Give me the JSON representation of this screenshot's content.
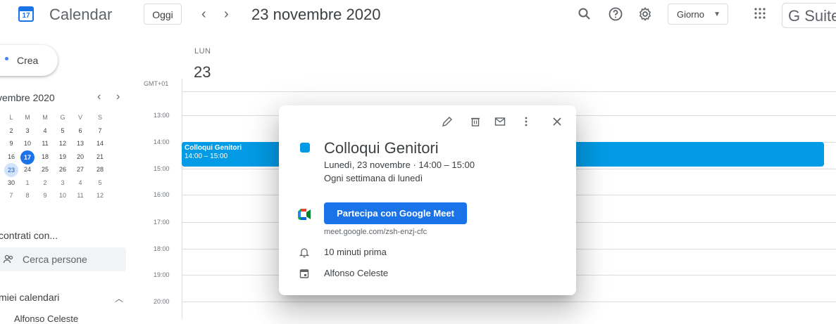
{
  "header": {
    "logo_day": "17",
    "app_title": "Calendar",
    "today_label": "Oggi",
    "prev_label": "‹",
    "next_label": "›",
    "date_title": "23 novembre 2020",
    "view_label": "Giorno",
    "gsuite_label": "G Suite"
  },
  "sidebar": {
    "create_label": "Crea",
    "mini_month": "vembre 2020",
    "weekdays": [
      "L",
      "M",
      "M",
      "G",
      "V",
      "S"
    ],
    "weeks": [
      [
        "2",
        "3",
        "4",
        "5",
        "6",
        "7"
      ],
      [
        "9",
        "10",
        "11",
        "12",
        "13",
        "14"
      ],
      [
        "16",
        "17",
        "18",
        "19",
        "20",
        "21"
      ],
      [
        "23",
        "24",
        "25",
        "26",
        "27",
        "28"
      ],
      [
        "30",
        "1",
        "2",
        "3",
        "4",
        "5"
      ],
      [
        "7",
        "8",
        "9",
        "10",
        "11",
        "12"
      ]
    ],
    "today": "17",
    "selected": "23",
    "meet_section": "contrati con...",
    "search_people": "Cerca persone",
    "my_calendars": "miei calendari",
    "calendar_item": "Alfonso Celeste"
  },
  "day_view": {
    "weekday": "LUN",
    "day_number": "23",
    "timezone": "GMT+01",
    "hours": [
      "13:00",
      "14:00",
      "15:00",
      "16:00",
      "17:00",
      "18:00",
      "19:00",
      "20:00"
    ]
  },
  "event": {
    "title": "Colloqui Genitori",
    "time": "14:00 – 15:00",
    "color": "#039be5"
  },
  "popup": {
    "title": "Colloqui Genitori",
    "date_time": "Lunedì, 23 novembre  ·  14:00 – 15:00",
    "recurrence": "Ogni settimana di lunedì",
    "meet_button": "Partecipa con Google Meet",
    "meet_link": "meet.google.com/zsh-enzj-cfc",
    "reminder": "10 minuti prima",
    "organizer": "Alfonso Celeste",
    "icons": [
      "pencil-icon",
      "trash-icon",
      "mail-icon",
      "more-vert-icon",
      "close-icon"
    ]
  },
  "colors": {
    "accent": "#1a73e8",
    "event": "#039be5",
    "text": "#3c4043"
  }
}
